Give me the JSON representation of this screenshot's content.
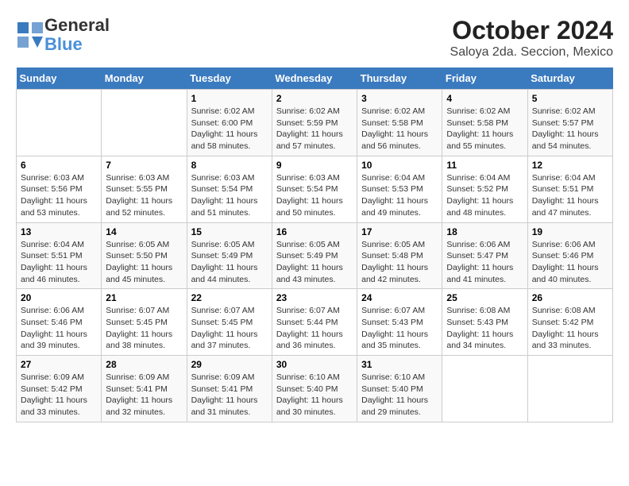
{
  "logo": {
    "line1": "General",
    "line2": "Blue"
  },
  "title": "October 2024",
  "subtitle": "Saloya 2da. Seccion, Mexico",
  "days_of_week": [
    "Sunday",
    "Monday",
    "Tuesday",
    "Wednesday",
    "Thursday",
    "Friday",
    "Saturday"
  ],
  "weeks": [
    [
      {
        "day": "",
        "info": ""
      },
      {
        "day": "",
        "info": ""
      },
      {
        "day": "1",
        "info": "Sunrise: 6:02 AM\nSunset: 6:00 PM\nDaylight: 11 hours and 58 minutes."
      },
      {
        "day": "2",
        "info": "Sunrise: 6:02 AM\nSunset: 5:59 PM\nDaylight: 11 hours and 57 minutes."
      },
      {
        "day": "3",
        "info": "Sunrise: 6:02 AM\nSunset: 5:58 PM\nDaylight: 11 hours and 56 minutes."
      },
      {
        "day": "4",
        "info": "Sunrise: 6:02 AM\nSunset: 5:58 PM\nDaylight: 11 hours and 55 minutes."
      },
      {
        "day": "5",
        "info": "Sunrise: 6:02 AM\nSunset: 5:57 PM\nDaylight: 11 hours and 54 minutes."
      }
    ],
    [
      {
        "day": "6",
        "info": "Sunrise: 6:03 AM\nSunset: 5:56 PM\nDaylight: 11 hours and 53 minutes."
      },
      {
        "day": "7",
        "info": "Sunrise: 6:03 AM\nSunset: 5:55 PM\nDaylight: 11 hours and 52 minutes."
      },
      {
        "day": "8",
        "info": "Sunrise: 6:03 AM\nSunset: 5:54 PM\nDaylight: 11 hours and 51 minutes."
      },
      {
        "day": "9",
        "info": "Sunrise: 6:03 AM\nSunset: 5:54 PM\nDaylight: 11 hours and 50 minutes."
      },
      {
        "day": "10",
        "info": "Sunrise: 6:04 AM\nSunset: 5:53 PM\nDaylight: 11 hours and 49 minutes."
      },
      {
        "day": "11",
        "info": "Sunrise: 6:04 AM\nSunset: 5:52 PM\nDaylight: 11 hours and 48 minutes."
      },
      {
        "day": "12",
        "info": "Sunrise: 6:04 AM\nSunset: 5:51 PM\nDaylight: 11 hours and 47 minutes."
      }
    ],
    [
      {
        "day": "13",
        "info": "Sunrise: 6:04 AM\nSunset: 5:51 PM\nDaylight: 11 hours and 46 minutes."
      },
      {
        "day": "14",
        "info": "Sunrise: 6:05 AM\nSunset: 5:50 PM\nDaylight: 11 hours and 45 minutes."
      },
      {
        "day": "15",
        "info": "Sunrise: 6:05 AM\nSunset: 5:49 PM\nDaylight: 11 hours and 44 minutes."
      },
      {
        "day": "16",
        "info": "Sunrise: 6:05 AM\nSunset: 5:49 PM\nDaylight: 11 hours and 43 minutes."
      },
      {
        "day": "17",
        "info": "Sunrise: 6:05 AM\nSunset: 5:48 PM\nDaylight: 11 hours and 42 minutes."
      },
      {
        "day": "18",
        "info": "Sunrise: 6:06 AM\nSunset: 5:47 PM\nDaylight: 11 hours and 41 minutes."
      },
      {
        "day": "19",
        "info": "Sunrise: 6:06 AM\nSunset: 5:46 PM\nDaylight: 11 hours and 40 minutes."
      }
    ],
    [
      {
        "day": "20",
        "info": "Sunrise: 6:06 AM\nSunset: 5:46 PM\nDaylight: 11 hours and 39 minutes."
      },
      {
        "day": "21",
        "info": "Sunrise: 6:07 AM\nSunset: 5:45 PM\nDaylight: 11 hours and 38 minutes."
      },
      {
        "day": "22",
        "info": "Sunrise: 6:07 AM\nSunset: 5:45 PM\nDaylight: 11 hours and 37 minutes."
      },
      {
        "day": "23",
        "info": "Sunrise: 6:07 AM\nSunset: 5:44 PM\nDaylight: 11 hours and 36 minutes."
      },
      {
        "day": "24",
        "info": "Sunrise: 6:07 AM\nSunset: 5:43 PM\nDaylight: 11 hours and 35 minutes."
      },
      {
        "day": "25",
        "info": "Sunrise: 6:08 AM\nSunset: 5:43 PM\nDaylight: 11 hours and 34 minutes."
      },
      {
        "day": "26",
        "info": "Sunrise: 6:08 AM\nSunset: 5:42 PM\nDaylight: 11 hours and 33 minutes."
      }
    ],
    [
      {
        "day": "27",
        "info": "Sunrise: 6:09 AM\nSunset: 5:42 PM\nDaylight: 11 hours and 33 minutes."
      },
      {
        "day": "28",
        "info": "Sunrise: 6:09 AM\nSunset: 5:41 PM\nDaylight: 11 hours and 32 minutes."
      },
      {
        "day": "29",
        "info": "Sunrise: 6:09 AM\nSunset: 5:41 PM\nDaylight: 11 hours and 31 minutes."
      },
      {
        "day": "30",
        "info": "Sunrise: 6:10 AM\nSunset: 5:40 PM\nDaylight: 11 hours and 30 minutes."
      },
      {
        "day": "31",
        "info": "Sunrise: 6:10 AM\nSunset: 5:40 PM\nDaylight: 11 hours and 29 minutes."
      },
      {
        "day": "",
        "info": ""
      },
      {
        "day": "",
        "info": ""
      }
    ]
  ]
}
